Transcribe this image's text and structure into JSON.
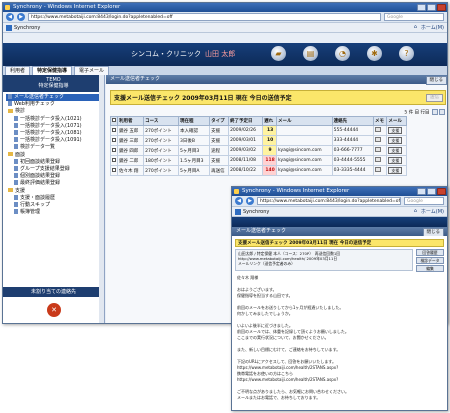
{
  "browser": {
    "title": "Synchrony - Windows Internet Explorer",
    "url": "https://www.metabotaiji.com:8443/login.do?appletenabled=off",
    "search_placeholder": "Google",
    "tab_label": "Synchrony",
    "toolbar_home": "ホーム(M)"
  },
  "app": {
    "clinic_name": "シンコム・クリニック",
    "user_name": "山田 太郎",
    "tabs": [
      "利用者",
      "特定保健指導",
      "電子メール"
    ],
    "icons": [
      "folder-icon",
      "document-icon",
      "chart-icon",
      "gear-icon",
      "help-icon"
    ]
  },
  "sidebar": {
    "header_line1": "TEMO",
    "header_line2": "特定保健指導",
    "items": [
      {
        "label": "メール送信者チェック",
        "level": 1,
        "selected": true,
        "icon": "doc"
      },
      {
        "label": "Web利用チェック",
        "level": 1,
        "icon": "doc"
      },
      {
        "label": "検診",
        "level": 1,
        "icon": "fold"
      },
      {
        "label": "一括検診データ投入(1021)",
        "level": 2,
        "icon": "doc"
      },
      {
        "label": "一括検診データ投入(1071)",
        "level": 2,
        "icon": "doc"
      },
      {
        "label": "一括検診データ投入(1081)",
        "level": 2,
        "icon": "doc"
      },
      {
        "label": "一括検診データ投入(1091)",
        "level": 2,
        "icon": "doc"
      },
      {
        "label": "検診データ一覧",
        "level": 2,
        "icon": "doc"
      },
      {
        "label": "面談",
        "level": 1,
        "icon": "fold"
      },
      {
        "label": "初回面談結果登録",
        "level": 2,
        "icon": "doc"
      },
      {
        "label": "グループ支援結果登録",
        "level": 2,
        "icon": "doc"
      },
      {
        "label": "個別面談結果登録",
        "level": 2,
        "icon": "doc"
      },
      {
        "label": "最終評価結果登録",
        "level": 2,
        "icon": "doc"
      },
      {
        "label": "支援",
        "level": 1,
        "icon": "fold"
      },
      {
        "label": "支援・面談履歴",
        "level": 2,
        "icon": "doc"
      },
      {
        "label": "行動スキップ",
        "level": 2,
        "icon": "doc"
      },
      {
        "label": "帳簿管理",
        "level": 2,
        "icon": "doc"
      }
    ],
    "unassigned": "未割り当ての連絡先"
  },
  "main": {
    "window_title": "メール送信者チェック",
    "close_label": "閉じる",
    "heading": "支援メール送信チェック 2009年03月11日 現在 今日の送信予定",
    "send_button": "送信",
    "pager": "5 件 目 行目",
    "columns": [
      "利用者",
      "コース",
      "現在程",
      "タイプ",
      "終了予定日",
      "遅れ",
      "メール",
      "連絡先",
      "メモ",
      "メール"
    ],
    "rows": [
      {
        "name": "鏡谷 五郎",
        "course": "270ポイント",
        "stage": "本入確認",
        "type": "支援",
        "end": "2009/02/26",
        "delay": "13",
        "delay_red": false,
        "mail": "",
        "contact": "555-44444",
        "reply": "支援"
      },
      {
        "name": "鏡谷 三郎",
        "course": "270ポイント",
        "stage": "3日後B",
        "type": "支援",
        "end": "2009/03/01",
        "delay": "10",
        "delay_red": false,
        "mail": "",
        "contact": "333-44444",
        "reply": "支援"
      },
      {
        "name": "鏡谷 四郎",
        "course": "270ポイント",
        "stage": "5ヶ月目3",
        "type": "途程",
        "end": "2009/03/02",
        "delay": "9",
        "delay_red": false,
        "mail": "kyagi@sincom.com",
        "contact": "03-666-7777",
        "reply": "支援"
      },
      {
        "name": "鏡谷 二郎",
        "course": "180ポイント",
        "stage": "1.5ヶ月目3",
        "type": "支援",
        "end": "2008/11/08",
        "delay": "118",
        "delay_red": true,
        "mail": "kyagi@sincom.com",
        "contact": "03-4444-5555",
        "reply": "支援"
      },
      {
        "name": "佐々木 翔",
        "course": "270ポイント",
        "stage": "5ヶ月目A",
        "type": "再送信",
        "end": "2008/10/22",
        "delay": "140",
        "delay_red": true,
        "mail": "kyagi@sincom.com",
        "contact": "03-3335-4444",
        "reply": "支援"
      }
    ]
  },
  "popup": {
    "title": "Synchrony - Windows Internet Explorer",
    "url": "https://www.metabotaiji.com:8443/login.do?appletenabled=off",
    "search_placeholder": "Google",
    "tab_label": "Synchrony",
    "toolbar_home": "ホーム(M)",
    "window_title": "メール送信者チェック",
    "close_label": "閉じる",
    "heading": "支援メール送信チェック 2009年03月11日 現在 今日の送信予定",
    "meta_lines": [
      "山田太郎 / 特定保健 本人（コース：270P）　再送信回数1回",
      "http://www.metabotaiji.com/health/ 2009年03月11日",
      "メールリンク（送信予定者のみ）"
    ],
    "btn_history": "回答履歴",
    "btn_data": "検診データ",
    "btn_edit": "編集",
    "body_lines": [
      "佐々木 翔様",
      "",
      "おはようございます。",
      "保健指導を担当する山田です。",
      "",
      "前回のメールをお送りしてから1ヶ月が経過いたしました。",
      "何かしてみましたでしょうか。",
      "",
      "いよいよ後半に近づきました。",
      "前回のメールでは、体重を記録して頂くようお願いしました。",
      "ここまでの実行状況について、お聞かせください。",
      "",
      "また、新しい目標にむけて、ご連絡をお待ちしています。",
      "",
      "下記のURLにアクセスして、回答をお願いいたします。",
      "https://www.metabotaiji.com/health/2STANS.aspx?",
      "携帯電話をお使いの方はこちら",
      "https://www.metabotaiji.com/health/2STANS.aspx?",
      "",
      "ご不明な点がありましたら、お気軽にお問い合わせください。",
      "メールまたはお電話で、お待ちしております。"
    ]
  }
}
